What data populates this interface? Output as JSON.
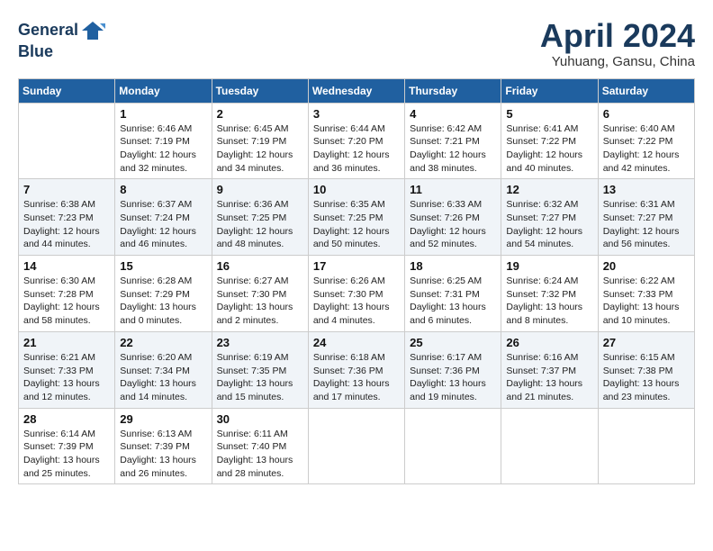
{
  "header": {
    "logo_line1": "General",
    "logo_line2": "Blue",
    "month_title": "April 2024",
    "location": "Yuhuang, Gansu, China"
  },
  "weekdays": [
    "Sunday",
    "Monday",
    "Tuesday",
    "Wednesday",
    "Thursday",
    "Friday",
    "Saturday"
  ],
  "weeks": [
    [
      {
        "day": "",
        "sunrise": "",
        "sunset": "",
        "daylight": ""
      },
      {
        "day": "1",
        "sunrise": "Sunrise: 6:46 AM",
        "sunset": "Sunset: 7:19 PM",
        "daylight": "Daylight: 12 hours and 32 minutes."
      },
      {
        "day": "2",
        "sunrise": "Sunrise: 6:45 AM",
        "sunset": "Sunset: 7:19 PM",
        "daylight": "Daylight: 12 hours and 34 minutes."
      },
      {
        "day": "3",
        "sunrise": "Sunrise: 6:44 AM",
        "sunset": "Sunset: 7:20 PM",
        "daylight": "Daylight: 12 hours and 36 minutes."
      },
      {
        "day": "4",
        "sunrise": "Sunrise: 6:42 AM",
        "sunset": "Sunset: 7:21 PM",
        "daylight": "Daylight: 12 hours and 38 minutes."
      },
      {
        "day": "5",
        "sunrise": "Sunrise: 6:41 AM",
        "sunset": "Sunset: 7:22 PM",
        "daylight": "Daylight: 12 hours and 40 minutes."
      },
      {
        "day": "6",
        "sunrise": "Sunrise: 6:40 AM",
        "sunset": "Sunset: 7:22 PM",
        "daylight": "Daylight: 12 hours and 42 minutes."
      }
    ],
    [
      {
        "day": "7",
        "sunrise": "Sunrise: 6:38 AM",
        "sunset": "Sunset: 7:23 PM",
        "daylight": "Daylight: 12 hours and 44 minutes."
      },
      {
        "day": "8",
        "sunrise": "Sunrise: 6:37 AM",
        "sunset": "Sunset: 7:24 PM",
        "daylight": "Daylight: 12 hours and 46 minutes."
      },
      {
        "day": "9",
        "sunrise": "Sunrise: 6:36 AM",
        "sunset": "Sunset: 7:25 PM",
        "daylight": "Daylight: 12 hours and 48 minutes."
      },
      {
        "day": "10",
        "sunrise": "Sunrise: 6:35 AM",
        "sunset": "Sunset: 7:25 PM",
        "daylight": "Daylight: 12 hours and 50 minutes."
      },
      {
        "day": "11",
        "sunrise": "Sunrise: 6:33 AM",
        "sunset": "Sunset: 7:26 PM",
        "daylight": "Daylight: 12 hours and 52 minutes."
      },
      {
        "day": "12",
        "sunrise": "Sunrise: 6:32 AM",
        "sunset": "Sunset: 7:27 PM",
        "daylight": "Daylight: 12 hours and 54 minutes."
      },
      {
        "day": "13",
        "sunrise": "Sunrise: 6:31 AM",
        "sunset": "Sunset: 7:27 PM",
        "daylight": "Daylight: 12 hours and 56 minutes."
      }
    ],
    [
      {
        "day": "14",
        "sunrise": "Sunrise: 6:30 AM",
        "sunset": "Sunset: 7:28 PM",
        "daylight": "Daylight: 12 hours and 58 minutes."
      },
      {
        "day": "15",
        "sunrise": "Sunrise: 6:28 AM",
        "sunset": "Sunset: 7:29 PM",
        "daylight": "Daylight: 13 hours and 0 minutes."
      },
      {
        "day": "16",
        "sunrise": "Sunrise: 6:27 AM",
        "sunset": "Sunset: 7:30 PM",
        "daylight": "Daylight: 13 hours and 2 minutes."
      },
      {
        "day": "17",
        "sunrise": "Sunrise: 6:26 AM",
        "sunset": "Sunset: 7:30 PM",
        "daylight": "Daylight: 13 hours and 4 minutes."
      },
      {
        "day": "18",
        "sunrise": "Sunrise: 6:25 AM",
        "sunset": "Sunset: 7:31 PM",
        "daylight": "Daylight: 13 hours and 6 minutes."
      },
      {
        "day": "19",
        "sunrise": "Sunrise: 6:24 AM",
        "sunset": "Sunset: 7:32 PM",
        "daylight": "Daylight: 13 hours and 8 minutes."
      },
      {
        "day": "20",
        "sunrise": "Sunrise: 6:22 AM",
        "sunset": "Sunset: 7:33 PM",
        "daylight": "Daylight: 13 hours and 10 minutes."
      }
    ],
    [
      {
        "day": "21",
        "sunrise": "Sunrise: 6:21 AM",
        "sunset": "Sunset: 7:33 PM",
        "daylight": "Daylight: 13 hours and 12 minutes."
      },
      {
        "day": "22",
        "sunrise": "Sunrise: 6:20 AM",
        "sunset": "Sunset: 7:34 PM",
        "daylight": "Daylight: 13 hours and 14 minutes."
      },
      {
        "day": "23",
        "sunrise": "Sunrise: 6:19 AM",
        "sunset": "Sunset: 7:35 PM",
        "daylight": "Daylight: 13 hours and 15 minutes."
      },
      {
        "day": "24",
        "sunrise": "Sunrise: 6:18 AM",
        "sunset": "Sunset: 7:36 PM",
        "daylight": "Daylight: 13 hours and 17 minutes."
      },
      {
        "day": "25",
        "sunrise": "Sunrise: 6:17 AM",
        "sunset": "Sunset: 7:36 PM",
        "daylight": "Daylight: 13 hours and 19 minutes."
      },
      {
        "day": "26",
        "sunrise": "Sunrise: 6:16 AM",
        "sunset": "Sunset: 7:37 PM",
        "daylight": "Daylight: 13 hours and 21 minutes."
      },
      {
        "day": "27",
        "sunrise": "Sunrise: 6:15 AM",
        "sunset": "Sunset: 7:38 PM",
        "daylight": "Daylight: 13 hours and 23 minutes."
      }
    ],
    [
      {
        "day": "28",
        "sunrise": "Sunrise: 6:14 AM",
        "sunset": "Sunset: 7:39 PM",
        "daylight": "Daylight: 13 hours and 25 minutes."
      },
      {
        "day": "29",
        "sunrise": "Sunrise: 6:13 AM",
        "sunset": "Sunset: 7:39 PM",
        "daylight": "Daylight: 13 hours and 26 minutes."
      },
      {
        "day": "30",
        "sunrise": "Sunrise: 6:11 AM",
        "sunset": "Sunset: 7:40 PM",
        "daylight": "Daylight: 13 hours and 28 minutes."
      },
      {
        "day": "",
        "sunrise": "",
        "sunset": "",
        "daylight": ""
      },
      {
        "day": "",
        "sunrise": "",
        "sunset": "",
        "daylight": ""
      },
      {
        "day": "",
        "sunrise": "",
        "sunset": "",
        "daylight": ""
      },
      {
        "day": "",
        "sunrise": "",
        "sunset": "",
        "daylight": ""
      }
    ]
  ]
}
